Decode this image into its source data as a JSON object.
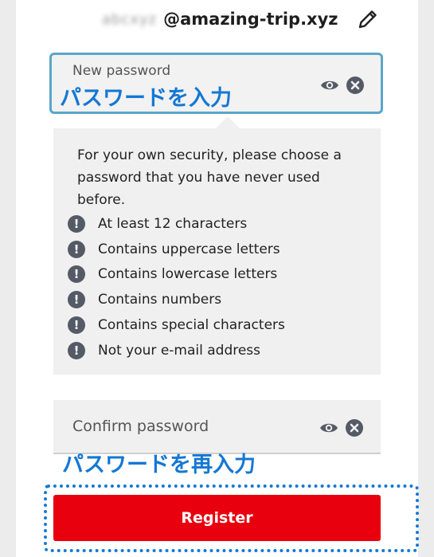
{
  "account": {
    "email_local": "abcxyz",
    "email_domain": "@amazing-trip.xyz"
  },
  "new_password": {
    "label": "New password",
    "annotation": "パスワードを入力"
  },
  "requirements": {
    "intro": "For your own security, please choose a password that you have never used before.",
    "items": [
      "At least 12 characters",
      "Contains uppercase letters",
      "Contains lowercase letters",
      "Contains numbers",
      "Contains special characters",
      "Not your e-mail address"
    ],
    "status_icon": "exclamation-circle-icon"
  },
  "confirm_password": {
    "label": "Confirm password",
    "annotation": "パスワードを再入力"
  },
  "register": {
    "label": "Register"
  },
  "colors": {
    "accent_red": "#e8000f",
    "focus_border": "#5aa6c9",
    "annotation_blue": "#1478d4"
  }
}
